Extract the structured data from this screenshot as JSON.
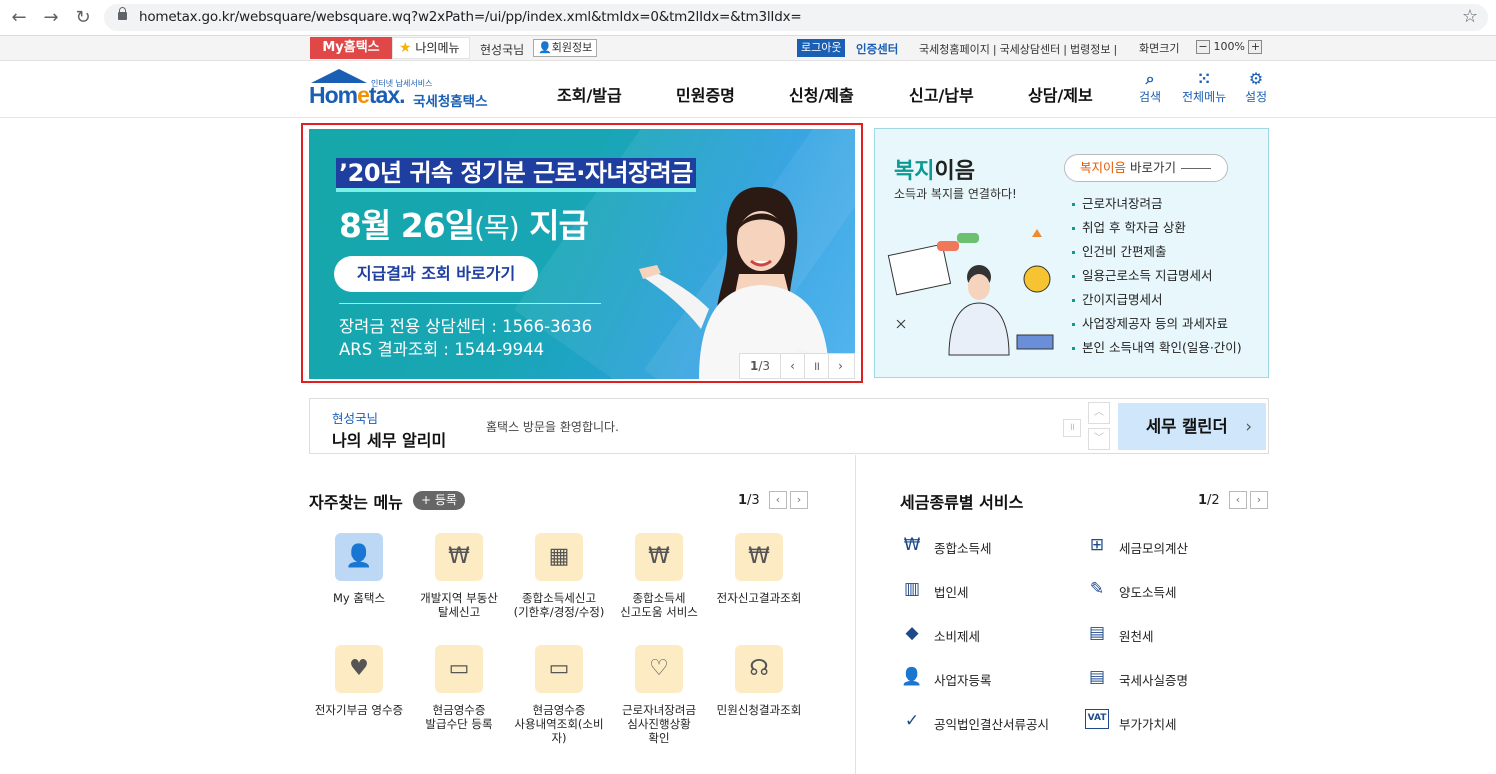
{
  "browser": {
    "url": "hometax.go.kr/websquare/websquare.wq?w2xPath=/ui/pp/index.xml&tmIdx=0&tm2lIdx=&tm3lIdx="
  },
  "util_bar": {
    "my_hometax": "My홈택스",
    "my_menu": "나의메뉴",
    "user_name": "현성국님",
    "member_info": "회원정보",
    "logout": "로그아웃",
    "cert_center": "인증센터",
    "links": [
      "국세청홈페이지",
      "국세상담센터",
      "법령정보"
    ],
    "screen_size": "화면크기",
    "zoom_minus": "−",
    "zoom_value": "100%",
    "zoom_plus": "+"
  },
  "header": {
    "logo_sub": "인터넷 납세서비스",
    "logo_main_a": "Hom",
    "logo_main_b": "e",
    "logo_main_c": "tax.",
    "logo_kr": "국세청홈택스",
    "nav": [
      "조회/발급",
      "민원증명",
      "신청/제출",
      "신고/납부",
      "상담/제보"
    ],
    "icons": [
      {
        "label": "검색",
        "icon": "search-icon",
        "glyph": "⌕"
      },
      {
        "label": "전체메뉴",
        "icon": "grid-menu-icon",
        "glyph": "⁙"
      },
      {
        "label": "설정",
        "icon": "gear-icon",
        "glyph": "⚙"
      }
    ]
  },
  "banner": {
    "line1": "’20년 귀속 정기분 근로·자녀장려금",
    "line2_a": "8월 26일",
    "line2_b": "(목)",
    "line2_c": " 지급",
    "button": "지급결과 조회 바로가기",
    "phone1": "장려금 전용 상담센터 : 1566-3636",
    "phone2": "ARS 결과조회 : 1544-9944",
    "pager_current": "1",
    "pager_total": "/3",
    "prev": "‹",
    "pause": "॥",
    "next": "›"
  },
  "welfare": {
    "title_a": "복지",
    "title_b": "이음",
    "subtitle": "소득과 복지를 연결하다!",
    "shortcut_a": "복지이음",
    "shortcut_b": " 바로가기",
    "items": [
      "근로자녀장려금",
      "취업 후 학자금 상환",
      "인건비 간편제출",
      "일용근로소득 지급명세서",
      "간이지급명세서",
      "사업장제공자 등의 과세자료",
      "본인 소득내역 확인(일용·간이)"
    ]
  },
  "notice": {
    "user": "현성국님",
    "title": "나의 세무 알리미",
    "message": "홈택스 방문을 환영합니다.",
    "calendar": "세무 캘린더",
    "calendar_arrow": "›",
    "pause": "॥",
    "up": "︿",
    "down": "﹀"
  },
  "favorites": {
    "title": "자주찾는 메뉴",
    "register": "+ 등록",
    "page_current": "1",
    "page_total": "/3",
    "prev": "‹",
    "next": "›",
    "items": [
      {
        "label": "My 홈택스",
        "icon": "user-icon",
        "glyph": "👤"
      },
      {
        "label": "개발지역 부동산\n탈세신고",
        "icon": "building-money-icon",
        "glyph": "₩"
      },
      {
        "label": "종합소득세신고\n(기한후/경정/수정)",
        "icon": "calendar-icon",
        "glyph": "▦"
      },
      {
        "label": "종합소득세\n신고도움 서비스",
        "icon": "money-search-icon",
        "glyph": "₩"
      },
      {
        "label": "전자신고결과조회",
        "icon": "search-money-icon",
        "glyph": "₩"
      },
      {
        "label": "전자기부금 영수증",
        "icon": "monitor-heart-icon",
        "glyph": "♥"
      },
      {
        "label": "현금영수증\n발급수단 등록",
        "icon": "card-icon",
        "glyph": "▭"
      },
      {
        "label": "현금영수증\n사용내역조회(소비\n자)",
        "icon": "card-search-icon",
        "glyph": "▭"
      },
      {
        "label": "근로자녀장려금\n심사진행상황\n확인",
        "icon": "heart-hand-icon",
        "glyph": "♡"
      },
      {
        "label": "민원신청결과조회",
        "icon": "headset-icon",
        "glyph": "☊"
      }
    ]
  },
  "tax_services": {
    "title": "세금종류별 서비스",
    "page_current": "1",
    "page_total": "/2",
    "prev": "‹",
    "next": "›",
    "items": [
      {
        "label": "종합소득세",
        "icon": "income-tax-icon",
        "glyph": "₩"
      },
      {
        "label": "세금모의계산",
        "icon": "calculator-icon",
        "glyph": "⊞"
      },
      {
        "label": "법인세",
        "icon": "corporate-building-icon",
        "glyph": "▥"
      },
      {
        "label": "양도소득세",
        "icon": "transfer-document-icon",
        "glyph": "✎"
      },
      {
        "label": "소비제세",
        "icon": "diamond-icon",
        "glyph": "◆"
      },
      {
        "label": "원천세",
        "icon": "withholding-document-icon",
        "glyph": "▤"
      },
      {
        "label": "사업자등록",
        "icon": "business-user-icon",
        "glyph": "👤"
      },
      {
        "label": "국세사실증명",
        "icon": "certificate-icon",
        "glyph": "▤"
      },
      {
        "label": "공익법인결산서류공시",
        "icon": "clipboard-check-icon",
        "glyph": "✓"
      },
      {
        "label": "부가가치세",
        "icon": "vat-icon",
        "glyph": "VAT"
      }
    ]
  }
}
